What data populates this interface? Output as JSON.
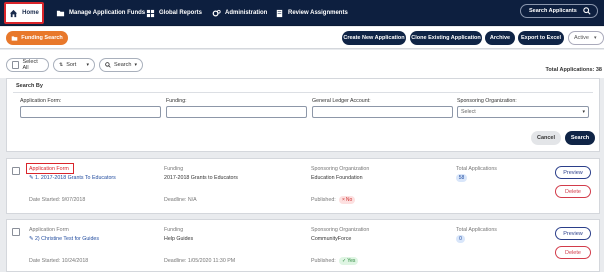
{
  "nav": {
    "items": [
      {
        "label": "Home",
        "icon": "home-icon"
      },
      {
        "label": "Manage Application Funds",
        "icon": "folder-icon"
      },
      {
        "label": "Global Reports",
        "icon": "grid-icon"
      },
      {
        "label": "Administration",
        "icon": "gears-icon"
      },
      {
        "label": "Review Assignments",
        "icon": "document-icon"
      }
    ],
    "search_label": "Search Applicants"
  },
  "toolbar": {
    "funding_search": "Funding Search",
    "create_new": "Create New Application",
    "clone_existing": "Clone Existing Application",
    "archive": "Archive",
    "export": "Export to Excel",
    "status_select": "Active"
  },
  "filters": {
    "select_all": "Select All",
    "sort": "Sort",
    "search": "Search",
    "total_label": "Total Applications: 38"
  },
  "search_by": {
    "title": "Search By",
    "application_form_label": "Application Form:",
    "funding_label": "Funding:",
    "gl_account_label": "General Ledger Account:",
    "sponsoring_org_label": "Sponsoring Organization:",
    "sponsoring_org_value": "Select",
    "cancel": "Cancel",
    "search": "Search"
  },
  "labels": {
    "application_form": "Application Form",
    "funding": "Funding",
    "sponsoring_org": "Sponsoring Organization",
    "total_applications": "Total Applications",
    "date_started": "Date Started:",
    "deadline": "Deadline:",
    "published": "Published:",
    "preview": "Preview",
    "delete": "Delete"
  },
  "results": [
    {
      "form_title": "1. 2017-2018 Grants To Educators",
      "funding": "2017-2018 Grants to Educators",
      "sponsoring_org": "Education Foundation",
      "total_apps": "58",
      "date_started": "9/07/2018",
      "deadline": "N/A",
      "published": "No"
    },
    {
      "form_title": "2) Christine Test for Guides",
      "funding": "Help Guides",
      "sponsoring_org": "CommunityForce",
      "total_apps": "0",
      "date_started": "10/24/2018",
      "deadline": "1/05/2020 11:30 PM",
      "published": "Yes"
    }
  ],
  "colors": {
    "nav_bg": "#0d1f3f",
    "accent_orange": "#e8782b",
    "button_navy": "#0f2446",
    "highlight_red": "#d9252b",
    "link_blue": "#1f4a9e"
  }
}
